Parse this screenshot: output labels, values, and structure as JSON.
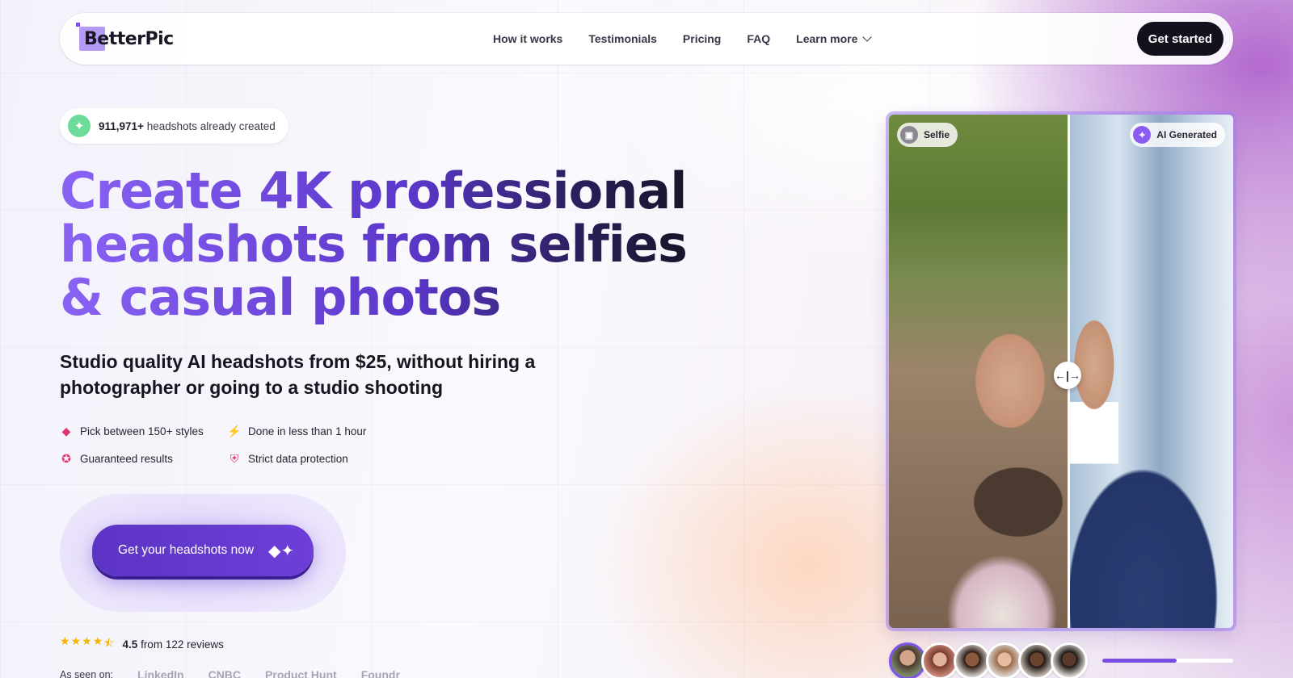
{
  "nav": {
    "logo": "BetterPic",
    "links": [
      "How it works",
      "Testimonials",
      "Pricing",
      "FAQ"
    ],
    "learn_more": "Learn more",
    "cta": "Get started"
  },
  "counter": {
    "count": "911,971+",
    "text": " headshots already created"
  },
  "headline": {
    "line1a": "Create 4K ",
    "line1b": "professional",
    "line2a": "headshots ",
    "line2b": "from selfies",
    "line3a": "& casual ",
    "line3b": "photos"
  },
  "subheadline": "Studio quality AI headshots from $25, without hiring a photographer or going to a studio shooting",
  "features": [
    {
      "icon": "tag-icon",
      "label": "Pick between 150+ styles"
    },
    {
      "icon": "lightning-icon",
      "label": "Done in less than 1 hour"
    },
    {
      "icon": "award-icon",
      "label": "Guaranteed results"
    },
    {
      "icon": "shield-icon",
      "label": "Strict data protection"
    }
  ],
  "cta": {
    "label": "Get your headshots now",
    "icon": "sparkle-icon"
  },
  "rating": {
    "value": "4.5",
    "text": "from 122 reviews",
    "stars": 4.5
  },
  "seen_on": {
    "label": "As seen on:",
    "brands": [
      "LinkedIn",
      "CNBC",
      "Product Hunt",
      "Foundr"
    ]
  },
  "compare": {
    "selfie_label": "Selfie",
    "ai_label": "AI Generated",
    "handle": "←|→"
  },
  "thumbnails": {
    "count": 6,
    "active_index": 0
  },
  "slideshow_progress": 0.57,
  "colors": {
    "accent": "#6d3fd8",
    "dark": "#13121c",
    "feature_icon": "#e0336f",
    "star": "#f5b400",
    "counter_badge": "#6ddc9a"
  }
}
